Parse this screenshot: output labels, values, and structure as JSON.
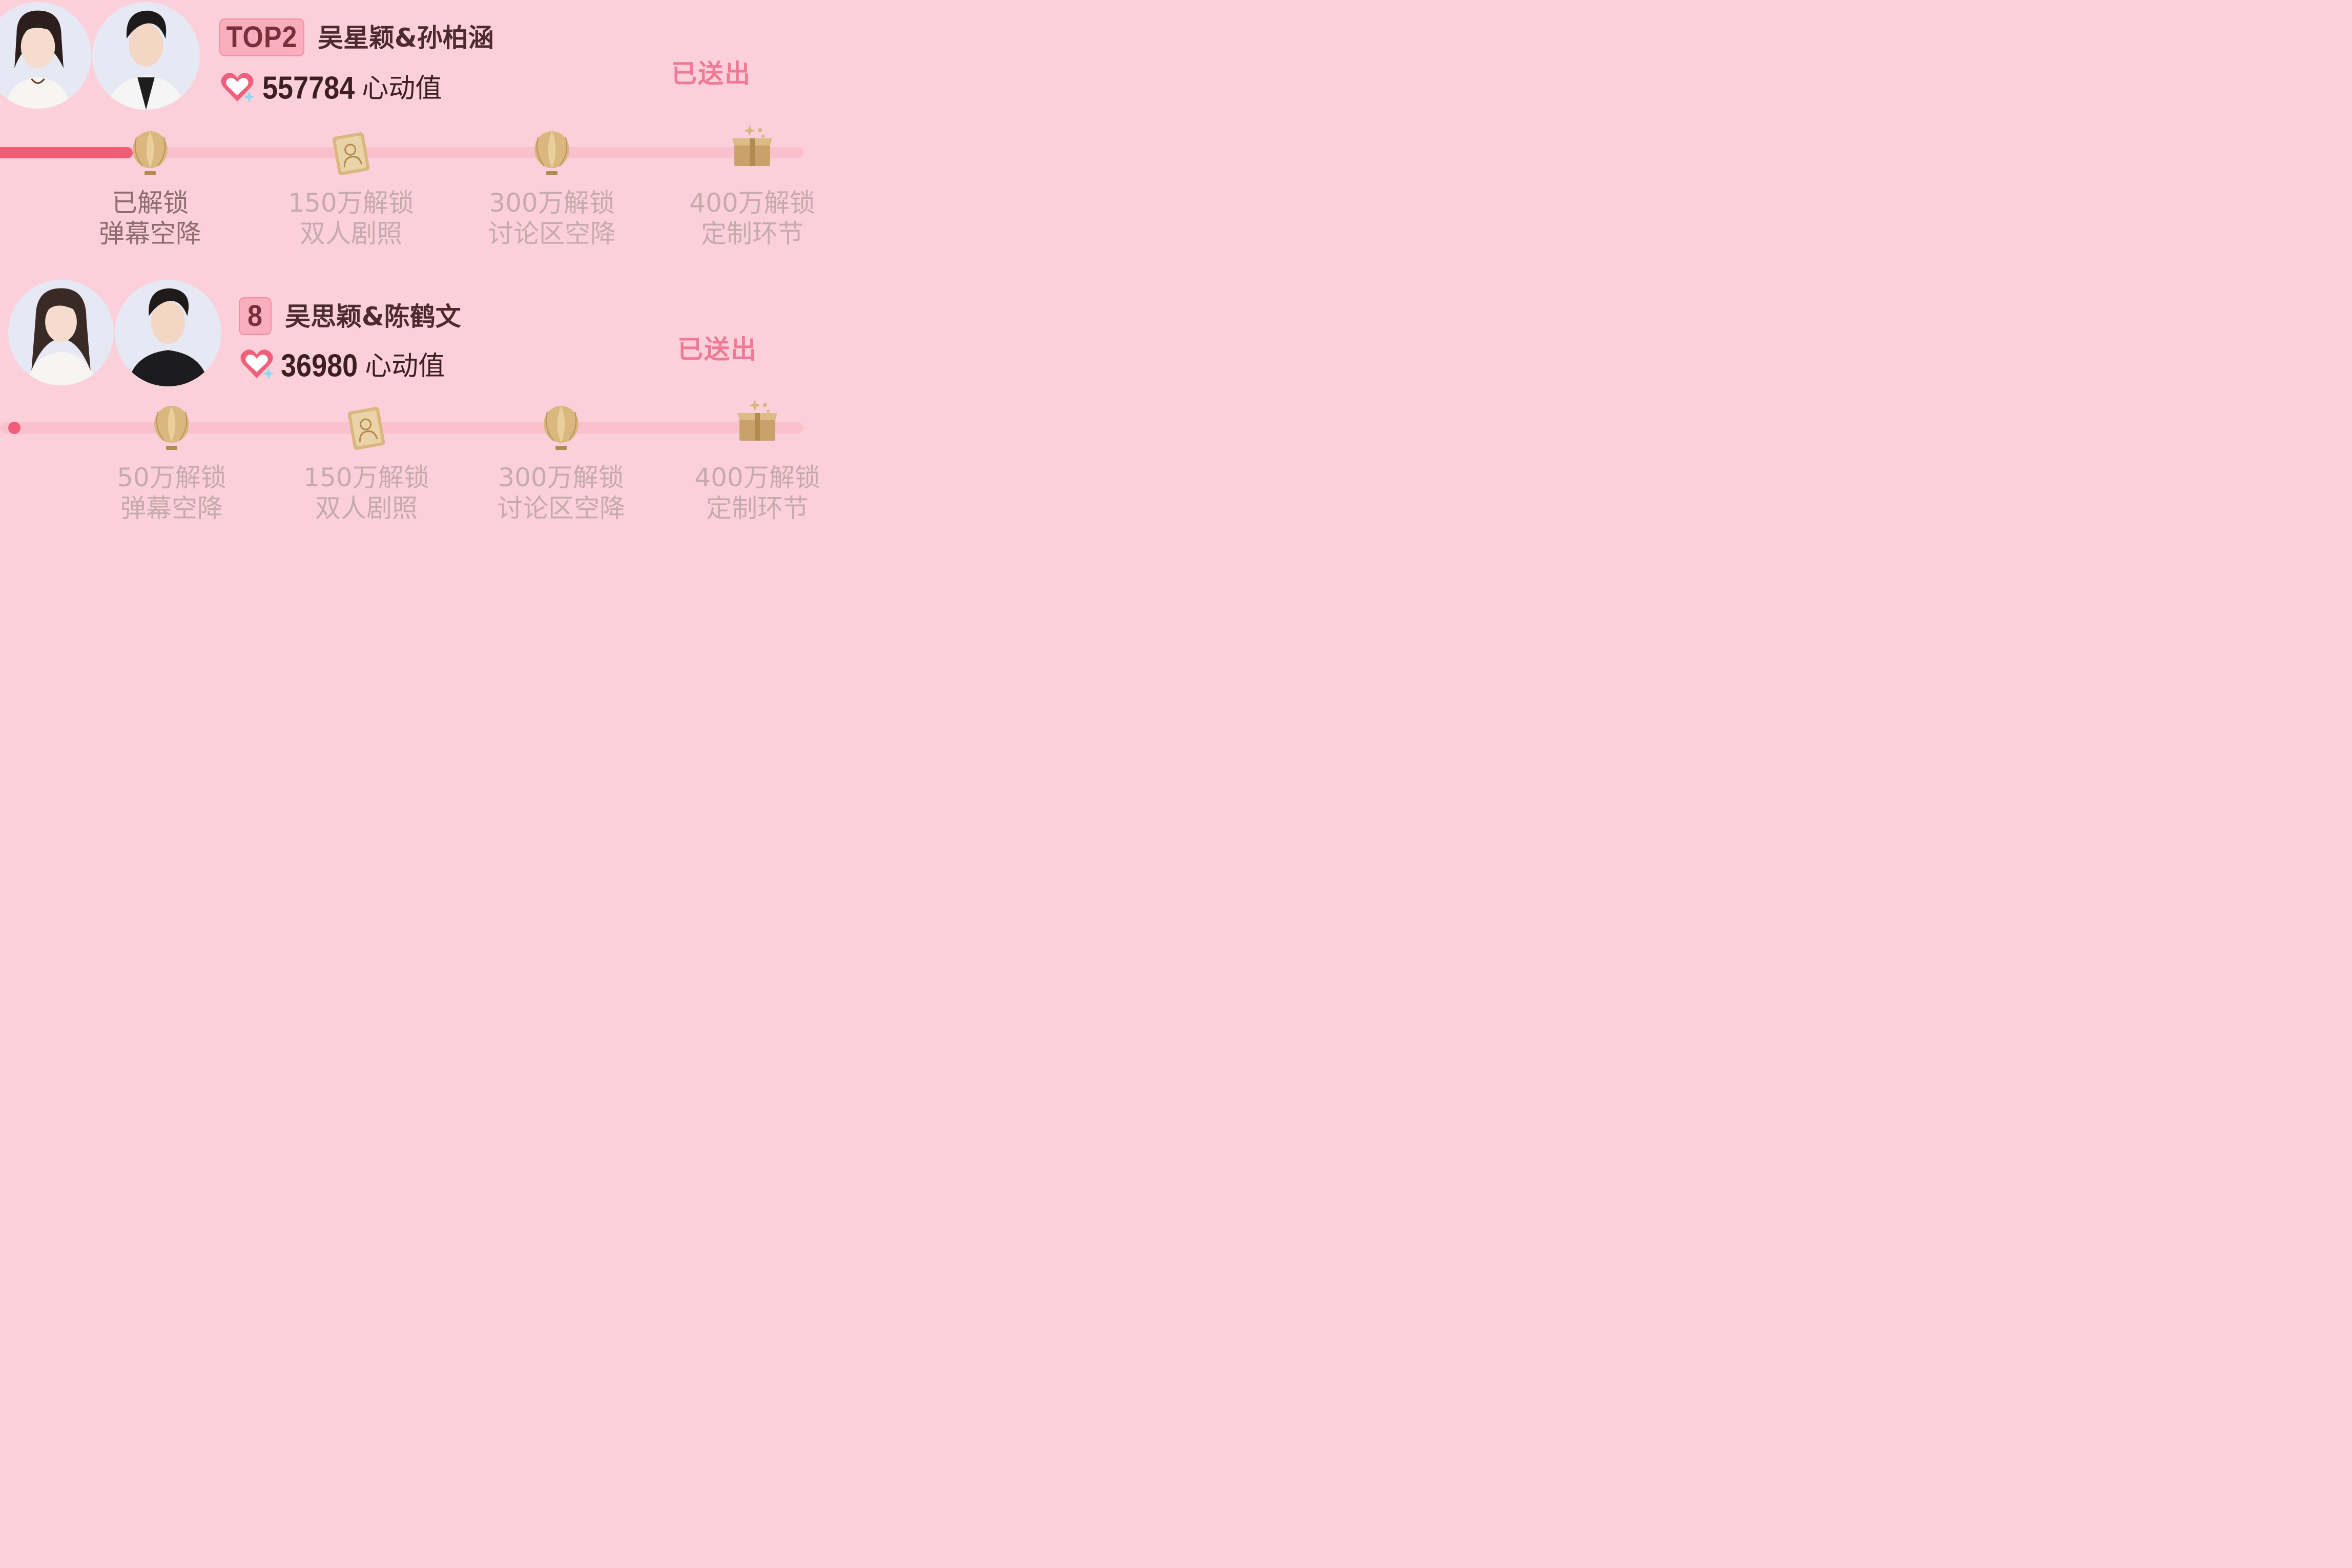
{
  "cards": [
    {
      "rank": "TOP2",
      "couple_name": "吴星颖&孙柏涵",
      "score": "557784",
      "score_unit": "心动值",
      "status": "已送出",
      "progress": 0.165,
      "milestones": [
        {
          "line1": "已解锁",
          "line2": "弹幕空降",
          "icon": "hot-air-balloon-icon",
          "unlocked": true
        },
        {
          "line1": "150万解锁",
          "line2": "双人剧照",
          "icon": "photo-card-icon",
          "unlocked": false
        },
        {
          "line1": "300万解锁",
          "line2": "讨论区空降",
          "icon": "hot-air-balloon-icon",
          "unlocked": false
        },
        {
          "line1": "400万解锁",
          "line2": "定制环节",
          "icon": "gift-box-icon",
          "unlocked": false
        }
      ]
    },
    {
      "rank": "8",
      "couple_name": "吴思颖&陈鹤文",
      "score": "36980",
      "score_unit": "心动值",
      "status": "已送出",
      "progress": 0.0,
      "milestones": [
        {
          "line1": "50万解锁",
          "line2": "弹幕空降",
          "icon": "hot-air-balloon-icon",
          "unlocked": false
        },
        {
          "line1": "150万解锁",
          "line2": "双人剧照",
          "icon": "photo-card-icon",
          "unlocked": false
        },
        {
          "line1": "300万解锁",
          "line2": "讨论区空降",
          "icon": "hot-air-balloon-icon",
          "unlocked": false
        },
        {
          "line1": "400万解锁",
          "line2": "定制环节",
          "icon": "gift-box-icon",
          "unlocked": false
        }
      ]
    }
  ],
  "colors": {
    "background": "#fbd0da",
    "progress_fill": "#f05d78",
    "track": "#f9c1cc",
    "status_text": "#f07a95",
    "icon_gold": "#c8a26a"
  }
}
